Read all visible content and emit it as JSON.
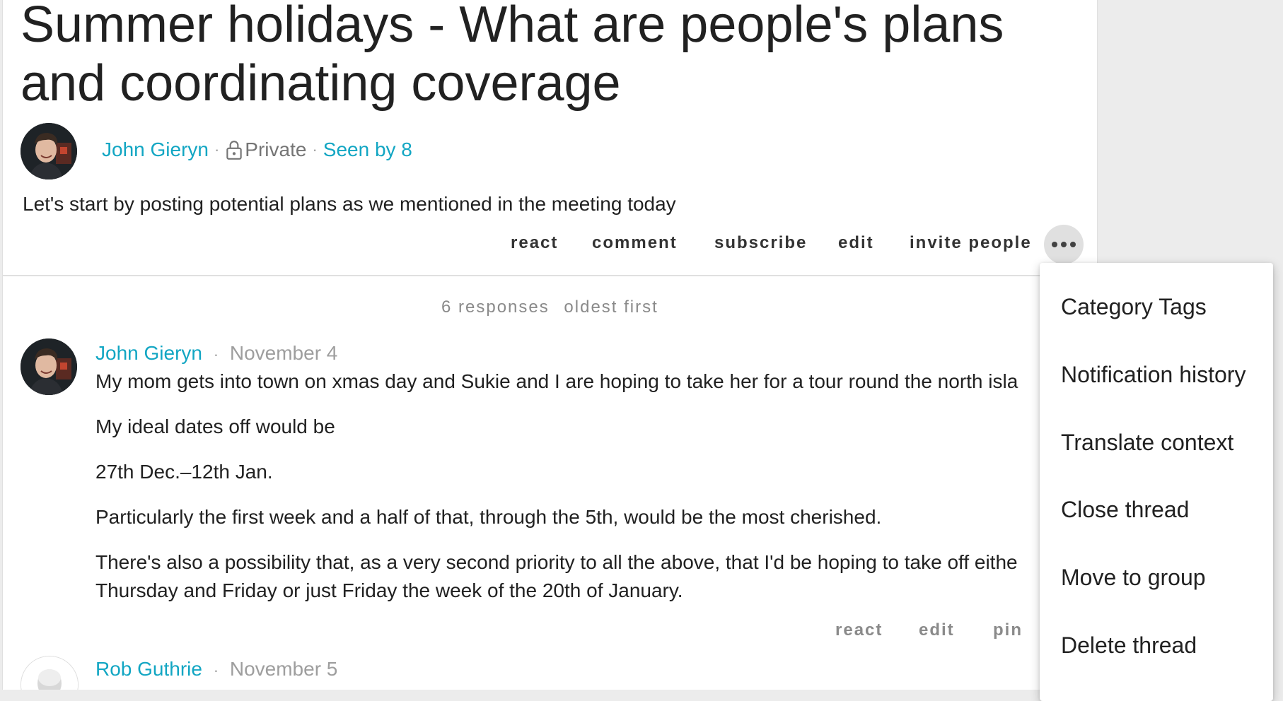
{
  "thread": {
    "title": "Summer holidays - What are people's plans and coordinating coverage",
    "author": "John Gieryn",
    "privacy": "Private",
    "seen_by": "Seen by 8",
    "separator": "·",
    "body": "Let's start by posting potential plans as we mentioned in the meeting today",
    "actions": {
      "react": "react",
      "comment": "comment",
      "subscribe": "subscribe",
      "edit": "edit",
      "invite_people": "invite people"
    }
  },
  "responses": {
    "count_label": "6 responses",
    "sort_label": "oldest first"
  },
  "comments": [
    {
      "author": "John Gieryn",
      "date": "November 4",
      "paragraphs": [
        "My mom gets into town on xmas day and Sukie and I are hoping to take her for a tour round the north isla",
        "My ideal dates off would be",
        "27th Dec.–12th Jan.",
        "Particularly the first week and a half of that, through the 5th, would be the most cherished.",
        "There's also a possibility that, as a very second priority to all the above, that I'd be hoping to take off eithe",
        "Thursday and Friday or just Friday the week of the 20th of January."
      ],
      "actions": {
        "react": "react",
        "edit": "edit",
        "pin": "pin"
      }
    },
    {
      "author": "Rob Guthrie",
      "date": "November 5"
    }
  ],
  "menu": {
    "items": [
      "Category Tags",
      "Notification history",
      "Translate context",
      "Close thread",
      "Move to group",
      "Delete thread"
    ]
  },
  "colors": {
    "link": "#12a6c3",
    "muted": "#9e9e9e",
    "text": "#212121",
    "background": "#ececec"
  },
  "icons": {
    "lock": "lock-icon",
    "more": "more-horizontal-icon"
  }
}
